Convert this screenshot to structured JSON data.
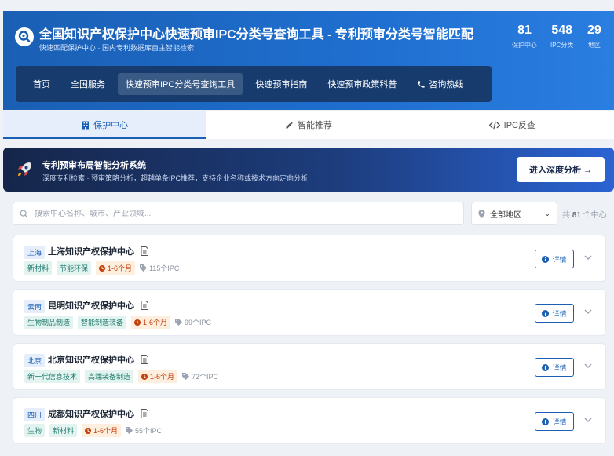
{
  "header": {
    "title": "全国知识产权保护中心快速预审IPC分类号查询工具 - 专利预审分类号智能匹配",
    "subtitle": "快速匹配保护中心 · 国内专利数据库自主智能检索",
    "stats": [
      {
        "num": "81",
        "label": "保护中心"
      },
      {
        "num": "548",
        "label": "IPC分类"
      },
      {
        "num": "29",
        "label": "地区"
      }
    ],
    "nav": [
      {
        "label": "首页"
      },
      {
        "label": "全国服务"
      },
      {
        "label": "快速预审IPC分类号查询工具"
      },
      {
        "label": "快速预审指南"
      },
      {
        "label": "快速预审政策科普"
      },
      {
        "label": "咨询热线"
      }
    ]
  },
  "tabs": [
    {
      "label": "保护中心"
    },
    {
      "label": "智能推荐"
    },
    {
      "label": "IPC反查"
    }
  ],
  "banner": {
    "title": "专利预审布局智能分析系统",
    "desc": "深度专利检索 · 预审策略分析，超越单条IPC推荐，支持企业名称或技术方向定向分析",
    "button": "进入深度分析 →"
  },
  "search": {
    "placeholder": "搜索中心名称、城市、产业领域...",
    "region": "全部地区",
    "count_prefix": "共",
    "count_num": "81",
    "count_suffix": "个中心"
  },
  "cards": [
    {
      "region": "上海",
      "name": "上海知识产权保护中心",
      "tags": [
        "新材料",
        "节能环保"
      ],
      "time": "1-6个月",
      "ipc": "115个IPC",
      "detail": "详情"
    },
    {
      "region": "云南",
      "name": "昆明知识产权保护中心",
      "tags": [
        "生物制品制造",
        "智能制造装备"
      ],
      "time": "1-6个月",
      "ipc": "99个IPC",
      "detail": "详情"
    },
    {
      "region": "北京",
      "name": "北京知识产权保护中心",
      "tags": [
        "新一代信息技术",
        "高端装备制造"
      ],
      "time": "1-6个月",
      "ipc": "72个IPC",
      "detail": "详情"
    },
    {
      "region": "四川",
      "name": "成都知识产权保护中心",
      "tags": [
        "生物",
        "新材料"
      ],
      "time": "1-6个月",
      "ipc": "55个IPC",
      "detail": "详情"
    }
  ],
  "colors": {
    "primary": "#1a5fb4",
    "nav_bg": "#173b6c",
    "banner_dark": "#16264a",
    "tag_time": "#c2410c"
  }
}
